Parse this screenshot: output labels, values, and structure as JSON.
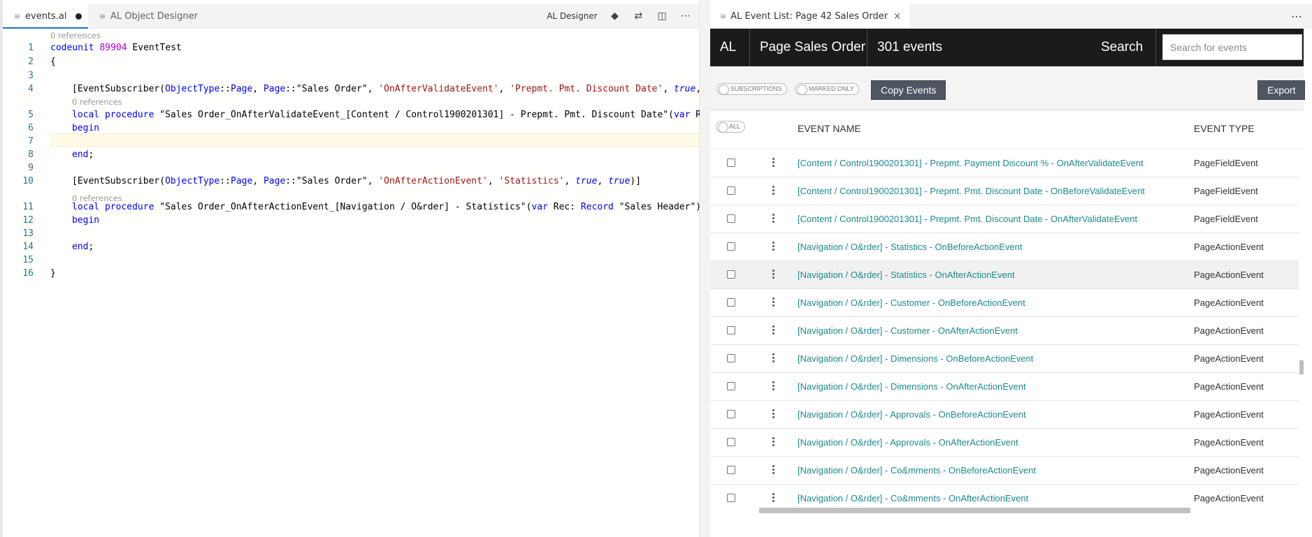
{
  "editor": {
    "tabs": [
      {
        "label": "events.al",
        "active": true,
        "dirty": true
      },
      {
        "label": "AL Object Designer",
        "active": false
      }
    ],
    "actions": {
      "designer_label": "AL Designer",
      "icons": [
        "git-compare-icon",
        "git-pull-request-icon",
        "split-editor-icon",
        "more-icon"
      ]
    },
    "lines": [
      {
        "n": "1",
        "text": "codeunit 89904 EventTest"
      },
      {
        "n": "2",
        "text": "{"
      },
      {
        "n": "3",
        "text": ""
      },
      {
        "n": "4",
        "text": "[EventSubscriber(ObjectType::Page, Page::\"Sales Order\", 'OnAfterValidateEvent', 'Prepmt. Pmt. Discount Date', true, tru"
      },
      {
        "n": "5",
        "text": "local procedure \"Sales Order_OnAfterValidateEvent_[Content / Control1900201301] - Prepmt. Pmt. Discount Date\"(var Rec:"
      },
      {
        "n": "6",
        "text": "begin"
      },
      {
        "n": "7",
        "text": ""
      },
      {
        "n": "8",
        "text": "end;"
      },
      {
        "n": "9",
        "text": ""
      },
      {
        "n": "10",
        "text": "[EventSubscriber(ObjectType::Page, Page::\"Sales Order\", 'OnAfterActionEvent', 'Statistics', true, true)]"
      },
      {
        "n": "11",
        "text": "local procedure \"Sales Order_OnAfterActionEvent_[Navigation / O&rder] - Statistics\"(var Rec: Record \"Sales Header\")"
      },
      {
        "n": "12",
        "text": "begin"
      },
      {
        "n": "13",
        "text": ""
      },
      {
        "n": "14",
        "text": "end;"
      },
      {
        "n": "15",
        "text": ""
      },
      {
        "n": "16",
        "text": "}"
      }
    ],
    "codelens": [
      "0 references",
      "0 references",
      "0 references"
    ]
  },
  "eventlist": {
    "tab_title": "AL Event List: Page 42 Sales Order",
    "header": {
      "lang": "AL",
      "object": "Page Sales Order",
      "count": "301 events",
      "search_label": "Search",
      "search_placeholder": "Search for events"
    },
    "toolbar": {
      "subscriptions": "SUBSCRIPTIONS",
      "marked_only": "MARKED ONLY",
      "copy_events": "Copy Events",
      "export": "Export"
    },
    "columns": {
      "all": "ALL",
      "event_name": "EVENT NAME",
      "event_type": "EVENT TYPE"
    },
    "rows": [
      {
        "name": "[Content / Control1900201301] - Prepmt. Payment Discount % - OnAfterValidateEvent",
        "type": "PageFieldEvent"
      },
      {
        "name": "[Content / Control1900201301] - Prepmt. Pmt. Discount Date - OnBeforeValidateEvent",
        "type": "PageFieldEvent"
      },
      {
        "name": "[Content / Control1900201301] - Prepmt. Pmt. Discount Date - OnAfterValidateEvent",
        "type": "PageFieldEvent"
      },
      {
        "name": "[Navigation / O&rder] - Statistics - OnBeforeActionEvent",
        "type": "PageActionEvent"
      },
      {
        "name": "[Navigation / O&rder] - Statistics - OnAfterActionEvent",
        "type": "PageActionEvent"
      },
      {
        "name": "[Navigation / O&rder] - Customer - OnBeforeActionEvent",
        "type": "PageActionEvent"
      },
      {
        "name": "[Navigation / O&rder] - Customer - OnAfterActionEvent",
        "type": "PageActionEvent"
      },
      {
        "name": "[Navigation / O&rder] - Dimensions - OnBeforeActionEvent",
        "type": "PageActionEvent"
      },
      {
        "name": "[Navigation / O&rder] - Dimensions - OnAfterActionEvent",
        "type": "PageActionEvent"
      },
      {
        "name": "[Navigation / O&rder] - Approvals - OnBeforeActionEvent",
        "type": "PageActionEvent"
      },
      {
        "name": "[Navigation / O&rder] - Approvals - OnAfterActionEvent",
        "type": "PageActionEvent"
      },
      {
        "name": "[Navigation / O&rder] - Co&mments - OnBeforeActionEvent",
        "type": "PageActionEvent"
      },
      {
        "name": "[Navigation / O&rder] - Co&mments - OnAfterActionEvent",
        "type": "PageActionEvent"
      }
    ]
  },
  "colors": {
    "accent": "#1a73c2",
    "event_name": "#1b8b8b",
    "header_bg": "#1b1b1b",
    "button_bg": "#4f5563"
  }
}
